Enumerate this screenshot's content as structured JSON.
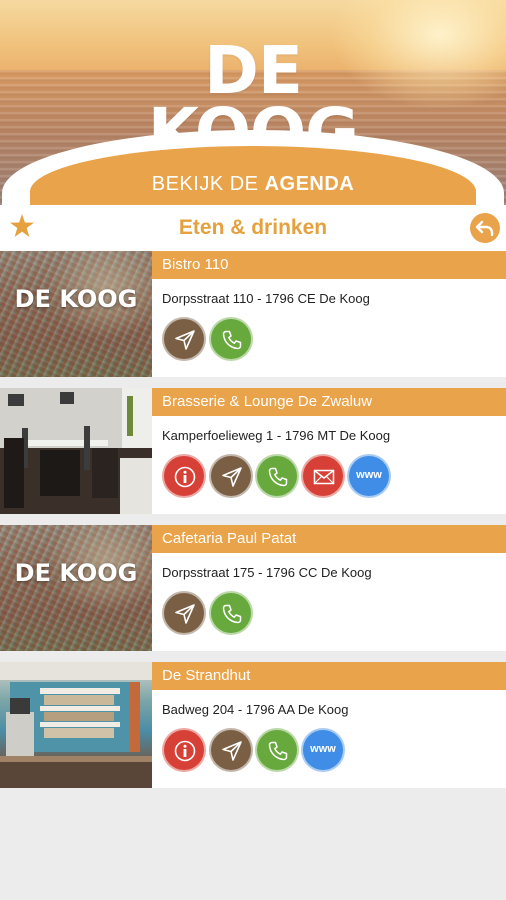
{
  "header": {
    "logo_text": "DE KOOG",
    "agenda_prefix": "BEKIJK DE ",
    "agenda_bold": "AGENDA"
  },
  "titlebar": {
    "title": "Eten & drinken",
    "favorite_icon": "star-icon",
    "back_icon": "back-arrow-icon"
  },
  "colors": {
    "accent": "#e9a34a",
    "info": "#d64036",
    "navigate": "#7b5f45",
    "phone": "#68a93e",
    "mail": "#d64036",
    "web": "#3f8de6"
  },
  "listings": [
    {
      "name": "Bistro 110",
      "address": "Dorpsstraat 110 - 1796 CE De Koog",
      "image_overlay": "DE KOOG",
      "actions": [
        "navigate",
        "phone"
      ]
    },
    {
      "name": "Brasserie & Lounge De Zwaluw",
      "address": "Kamperfoelieweg 1 - 1796 MT De Koog",
      "image_overlay": "",
      "actions": [
        "info",
        "navigate",
        "phone",
        "mail",
        "www"
      ]
    },
    {
      "name": "Cafetaria Paul Patat",
      "address": "Dorpsstraat 175 - 1796 CC De Koog",
      "image_overlay": "DE KOOG",
      "actions": [
        "navigate",
        "phone"
      ]
    },
    {
      "name": "De Strandhut",
      "address": "Badweg 204 - 1796 AA De Koog",
      "image_overlay": "",
      "actions": [
        "info",
        "navigate",
        "phone",
        "www"
      ]
    }
  ],
  "www_label": "www"
}
